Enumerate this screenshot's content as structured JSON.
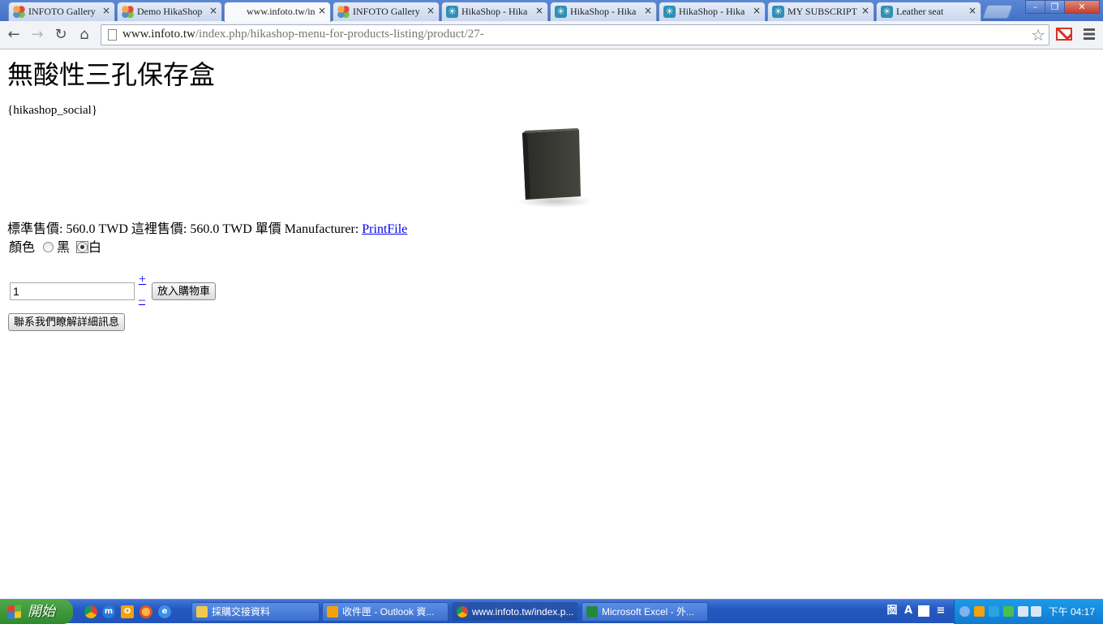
{
  "browser": {
    "tabs": [
      {
        "label": "INFOTO Gallery",
        "icon": "joomla-icon",
        "active": false
      },
      {
        "label": "Demo HikaShop",
        "icon": "joomla-icon",
        "active": false
      },
      {
        "label": "www.infoto.tw/in",
        "icon": "none",
        "active": true
      },
      {
        "label": "INFOTO Gallery",
        "icon": "joomla-icon",
        "active": false
      },
      {
        "label": "HikaShop - Hika",
        "icon": "hikashop-icon",
        "active": false
      },
      {
        "label": "HikaShop - Hika",
        "icon": "hikashop-icon",
        "active": false
      },
      {
        "label": "HikaShop - Hika",
        "icon": "hikashop-icon",
        "active": false
      },
      {
        "label": "MY SUBSCRIPT",
        "icon": "hikashop-icon",
        "active": false
      },
      {
        "label": "Leather seat",
        "icon": "hikashop-icon",
        "active": false
      }
    ],
    "tab_close_glyph": "×",
    "window_controls": {
      "minimize": "–",
      "maximize": "❐",
      "close": "✕"
    },
    "toolbar": {
      "back": "←",
      "forward": "→",
      "reload": "↻",
      "home": "⌂",
      "url_host": "www.infoto.tw",
      "url_path": "/index.php/hikashop-menu-for-products-listing/product/27-",
      "star": "☆"
    }
  },
  "product": {
    "title": "無酸性三孔保存盒",
    "social_placeholder": "{hikashop_social}",
    "price_line_prefix": "標準售價: 560.0 TWD 這裡售價: 560.0 TWD 單價 Manufacturer: ",
    "manufacturer_link": "PrintFile",
    "color_label": "顏色",
    "color_options": [
      {
        "label": "黑",
        "checked": false
      },
      {
        "label": "白",
        "checked": true
      }
    ],
    "quantity_value": "1",
    "qty_plus": "+",
    "qty_minus": "–",
    "add_to_cart_label": "放入購物車",
    "contact_label": "聯系我們瞭解詳細訊息"
  },
  "taskbar": {
    "start_label": "開始",
    "tasks": [
      {
        "label": "採購交接資料",
        "icon_color": "#f2c94c",
        "active": false
      },
      {
        "label": "收件匣 - Outlook 資...",
        "icon_color": "#f2a20c",
        "active": false
      },
      {
        "label": "www.infoto.tw/index.p...",
        "icon_color": "#e04a3a",
        "active": true
      },
      {
        "label": "Microsoft Excel - 外...",
        "icon_color": "#1f8b3a",
        "active": false
      }
    ],
    "lang_bar": [
      "囫",
      "A"
    ],
    "clock": "下午 04:17"
  },
  "colors": {
    "link": "#0000ee",
    "tabstrip": "#4271c6",
    "taskbar": "#2458bf",
    "tray": "#0f7cd1"
  }
}
